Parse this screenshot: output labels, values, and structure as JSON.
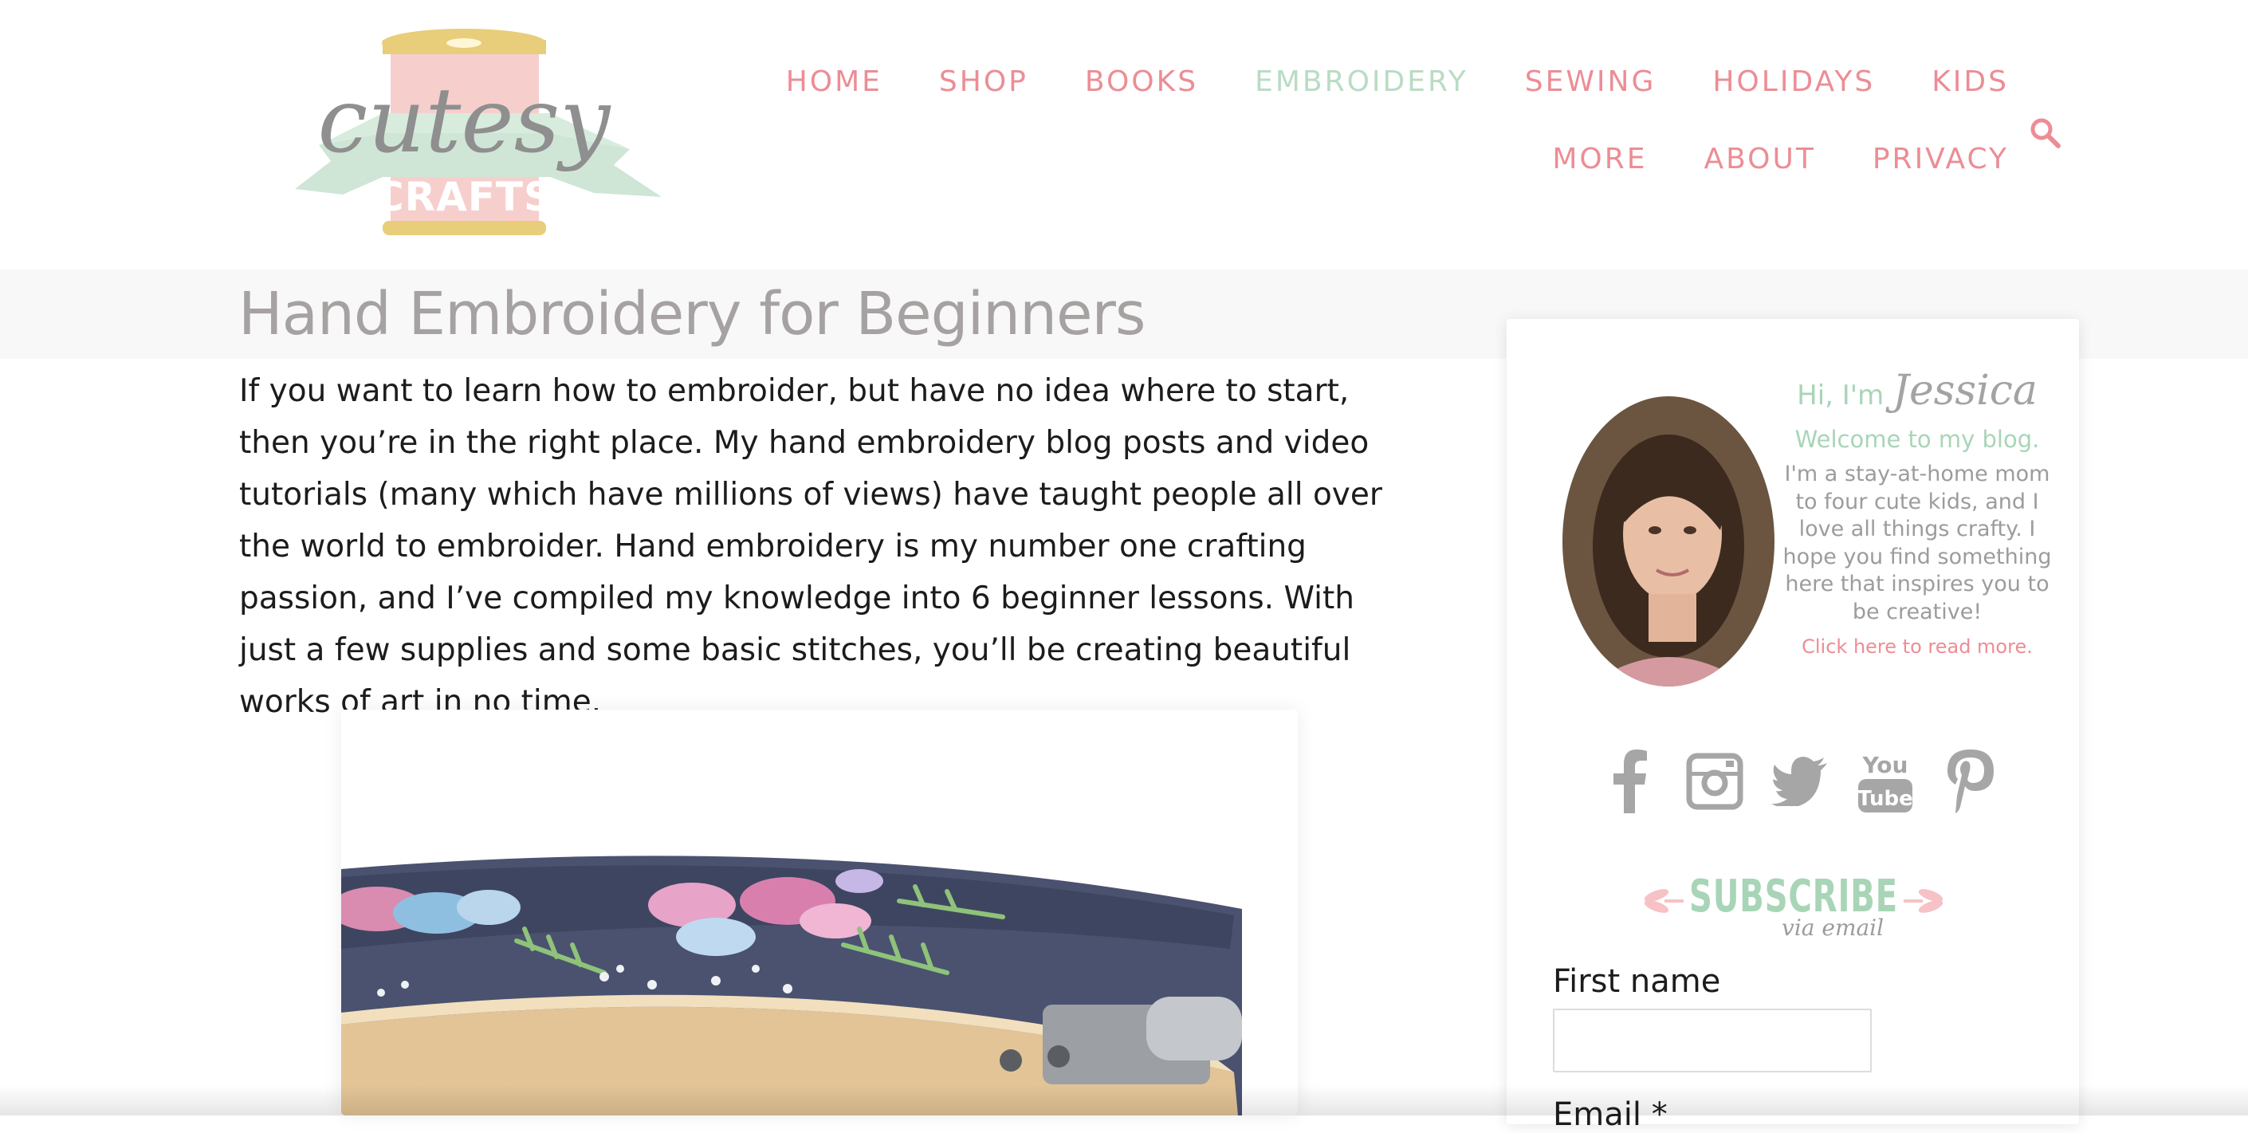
{
  "logo": {
    "line1": "cutesy",
    "line2": "CRAFTS"
  },
  "nav": {
    "row1": [
      "HOME",
      "SHOP",
      "BOOKS",
      "EMBROIDERY",
      "SEWING",
      "HOLIDAYS",
      "KIDS"
    ],
    "row2": [
      "MORE",
      "ABOUT",
      "PRIVACY"
    ],
    "active": "EMBROIDERY"
  },
  "page": {
    "title": "Hand Embroidery for Beginners",
    "intro": "If you want to learn how to embroider, but have no idea where to start, then you’re in the right place.  My hand embroidery blog posts and video tutorials (many which have millions of views) have taught people all over the world to embroider.  Hand embroidery is my number one crafting passion, and I’ve compiled my knowledge into 6 beginner lessons.  With just a few supplies and some basic stitches, you’ll be creating beautiful works of art in no time."
  },
  "sidebar": {
    "bio": {
      "hi": "Hi, I'm",
      "name": "Jessica",
      "welcome": "Welcome to my blog.",
      "text": "I'm a stay-at-home mom to four cute kids, and I love all things crafty. I hope you find something here that inspires you to be creative!",
      "link": "Click here to read more."
    },
    "social": [
      "facebook-icon",
      "instagram-icon",
      "twitter-icon",
      "youtube-icon",
      "pinterest-icon"
    ],
    "youtube_text": [
      "You",
      "Tube"
    ],
    "subscribe": {
      "title": "SUBSCRIBE",
      "sub": "via email"
    },
    "form": {
      "first_name_label": "First name",
      "first_name_value": "",
      "email_label": "Email *"
    }
  },
  "colors": {
    "pink": "#ec8d95",
    "mint": "#b9dcc3",
    "gray": "#a6a2a2",
    "text": "#1c1c1c"
  }
}
